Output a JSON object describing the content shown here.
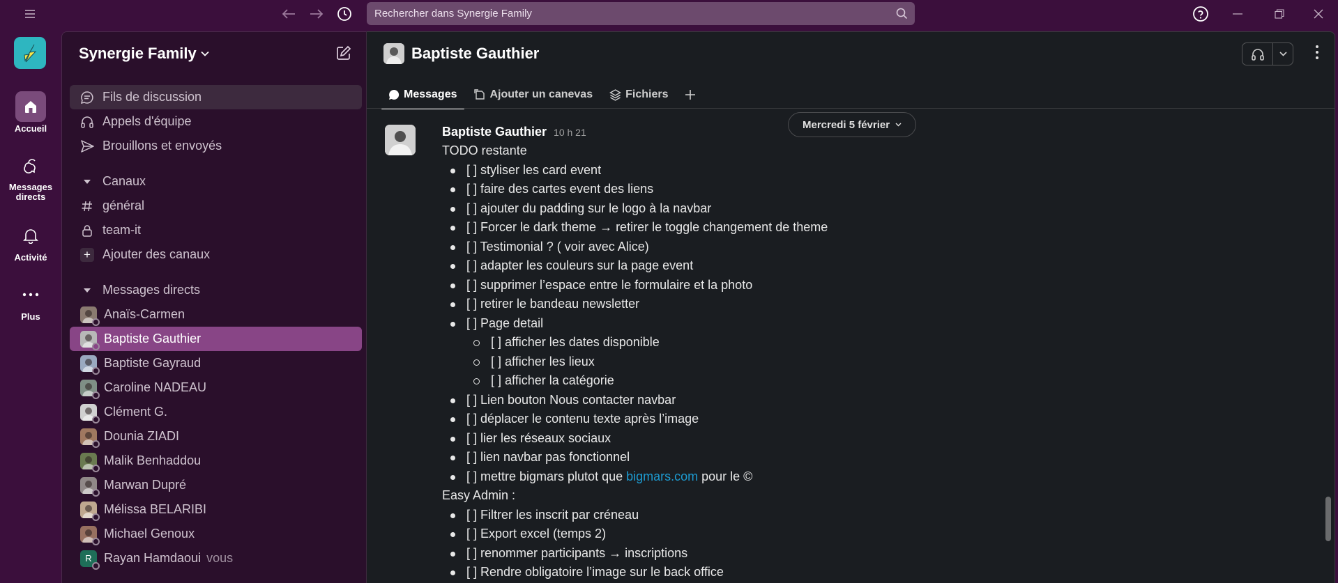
{
  "titlebar": {
    "search_placeholder": "Rechercher dans Synergie Family"
  },
  "rail": {
    "items": [
      {
        "label": "Accueil"
      },
      {
        "label": "Messages directs"
      },
      {
        "label": "Activité"
      },
      {
        "label": "Plus"
      }
    ]
  },
  "sidebar": {
    "workspace": "Synergie Family",
    "top_items": [
      "Fils de discussion",
      "Appels d'équipe",
      "Brouillons et envoyés"
    ],
    "channels_header": "Canaux",
    "channels": [
      "général",
      "team-it",
      "Ajouter des canaux"
    ],
    "dms_header": "Messages directs",
    "dms": [
      {
        "name": "Anaïs-Carmen",
        "color": "#8a7a70"
      },
      {
        "name": "Baptiste Gauthier",
        "color": "#b8b8b8"
      },
      {
        "name": "Baptiste Gayraud",
        "color": "#9aa9c0"
      },
      {
        "name": "Caroline NADEAU",
        "color": "#7f8f86"
      },
      {
        "name": "Clément G.",
        "color": "#d0d0d0"
      },
      {
        "name": "Dounia ZIADI",
        "color": "#a07860"
      },
      {
        "name": "Malik Benhaddou",
        "color": "#6a7a50"
      },
      {
        "name": "Marwan Dupré",
        "color": "#908888"
      },
      {
        "name": "Mélissa BELARIBI",
        "color": "#c0a890"
      },
      {
        "name": "Michael Genoux",
        "color": "#987060"
      },
      {
        "name": "Rayan Hamdaoui",
        "color": "#1e6e58",
        "initial": "R",
        "suffix": "vous"
      }
    ]
  },
  "main": {
    "channel_title": "Baptiste Gauthier",
    "tabs": [
      "Messages",
      "Ajouter un canevas",
      "Fichiers"
    ],
    "date_divider": "Mercredi 5 février",
    "message": {
      "author": "Baptiste Gauthier",
      "time": "10 h 21",
      "lines": [
        {
          "type": "text",
          "text": "TODO restante"
        },
        {
          "type": "li",
          "text": "[ ] styliser les card event"
        },
        {
          "type": "li",
          "text": "[ ] faire des cartes event des liens"
        },
        {
          "type": "li",
          "text": "[ ] ajouter du padding sur le logo à la navbar"
        },
        {
          "type": "li",
          "text": "[ ] Forcer le dark theme → retirer le toggle changement de theme"
        },
        {
          "type": "li",
          "text": "[ ] Testimonial ? ( voir avec Alice)"
        },
        {
          "type": "li",
          "text": "[ ] adapter les couleurs sur la page event"
        },
        {
          "type": "li",
          "text": "[ ] supprimer l’espace entre le formulaire et la photo"
        },
        {
          "type": "li",
          "text": "[ ] retirer le bandeau newsletter"
        },
        {
          "type": "li",
          "text": "[ ] Page detail"
        },
        {
          "type": "li2",
          "text": "[ ] afficher les dates disponible"
        },
        {
          "type": "li2",
          "text": "[ ] afficher les lieux"
        },
        {
          "type": "li2",
          "text": "[ ] afficher la catégorie"
        },
        {
          "type": "li",
          "text": "[ ] Lien bouton Nous contacter navbar"
        },
        {
          "type": "li",
          "text": "[ ] déplacer le contenu texte après l’image"
        },
        {
          "type": "li",
          "text": "[ ] lier les réseaux sociaux"
        },
        {
          "type": "li",
          "text": "[ ] lien navbar pas fonctionnel"
        },
        {
          "type": "li",
          "text": "[ ] mettre bigmars plutot que ",
          "link": "bigmars.com",
          "after": " pour le ©"
        },
        {
          "type": "text",
          "text": "Easy Admin :"
        },
        {
          "type": "li",
          "text": "[ ] Filtrer les inscrit par créneau"
        },
        {
          "type": "li",
          "text": "[ ] Export excel (temps 2)"
        },
        {
          "type": "li",
          "text": "[ ] renommer participants → inscriptions"
        },
        {
          "type": "li",
          "text": "[ ] Rendre obligatoire l’image sur le back office"
        }
      ]
    }
  },
  "colors": {
    "sidebar_bg": "#2a0f2b",
    "selected": "#884586",
    "main_bg": "#1a1d21",
    "link": "#1d9bd1"
  }
}
